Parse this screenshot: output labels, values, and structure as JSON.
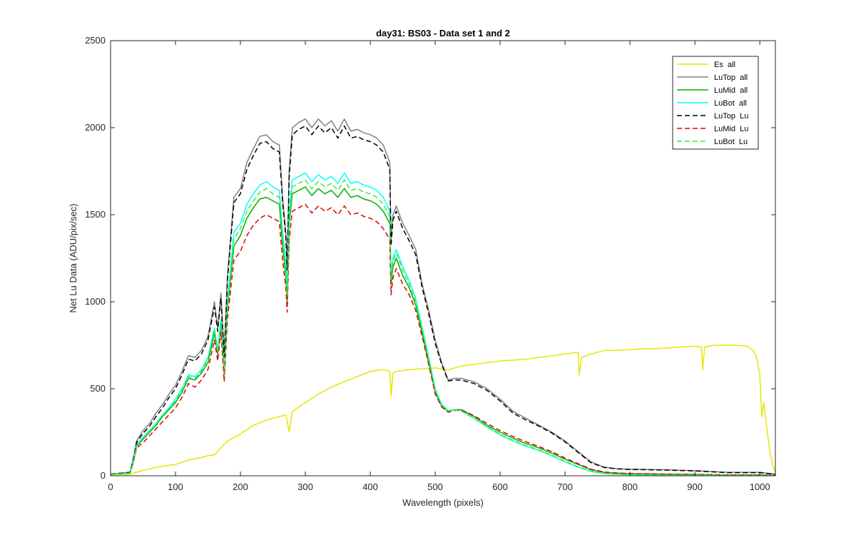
{
  "chart_data": {
    "type": "line",
    "title": "day31: BS03 - Data set 1 and 2",
    "xlabel": "Wavelength (pixels)",
    "ylabel": "Net Lu Data (ADU/pix/sec)",
    "xlim": [
      0,
      1024
    ],
    "ylim": [
      0,
      2500
    ],
    "xticks": [
      0,
      100,
      200,
      300,
      400,
      500,
      600,
      700,
      800,
      900,
      1000
    ],
    "yticks": [
      0,
      500,
      1000,
      1500,
      2000,
      2500
    ],
    "grid": false,
    "legend_position": "top-right",
    "series": [
      {
        "name": "Es  all",
        "color": "#e6e600",
        "dash": "solid",
        "x": [
          0,
          30,
          40,
          50,
          60,
          80,
          100,
          120,
          140,
          150,
          160,
          170,
          180,
          200,
          220,
          240,
          260,
          270,
          275,
          280,
          300,
          320,
          340,
          360,
          380,
          400,
          420,
          430,
          432,
          435,
          440,
          460,
          480,
          500,
          520,
          540,
          560,
          580,
          600,
          620,
          640,
          660,
          680,
          700,
          720,
          722,
          725,
          740,
          760,
          780,
          800,
          820,
          840,
          860,
          880,
          900,
          910,
          912,
          915,
          930,
          960,
          980,
          990,
          995,
          1000,
          1003,
          1006,
          1010,
          1015,
          1020,
          1024
        ],
        "y": [
          5,
          8,
          20,
          30,
          40,
          55,
          65,
          90,
          105,
          115,
          120,
          160,
          200,
          240,
          290,
          320,
          340,
          350,
          255,
          370,
          420,
          470,
          510,
          540,
          570,
          600,
          610,
          600,
          460,
          590,
          600,
          610,
          615,
          620,
          610,
          630,
          640,
          650,
          660,
          665,
          670,
          680,
          690,
          700,
          710,
          580,
          680,
          700,
          720,
          720,
          725,
          730,
          730,
          735,
          740,
          745,
          740,
          610,
          740,
          750,
          750,
          745,
          720,
          680,
          580,
          340,
          420,
          300,
          150,
          60,
          20
        ]
      },
      {
        "name": "LuTop  all",
        "color": "#808080",
        "dash": "solid",
        "x": [
          0,
          30,
          35,
          40,
          50,
          60,
          70,
          80,
          90,
          100,
          110,
          120,
          130,
          140,
          150,
          160,
          165,
          170,
          175,
          180,
          190,
          200,
          210,
          220,
          230,
          240,
          250,
          260,
          265,
          270,
          272,
          275,
          280,
          290,
          300,
          310,
          320,
          330,
          340,
          350,
          360,
          370,
          380,
          390,
          400,
          410,
          420,
          430,
          432,
          435,
          440,
          450,
          460,
          470,
          480,
          490,
          500,
          510,
          520,
          530,
          540,
          560,
          580,
          600,
          620,
          640,
          660,
          680,
          700,
          720,
          740,
          760,
          780,
          800,
          850,
          900,
          950,
          1000,
          1024
        ],
        "y": [
          10,
          20,
          100,
          200,
          260,
          300,
          360,
          410,
          470,
          520,
          600,
          690,
          680,
          720,
          800,
          1000,
          850,
          1050,
          700,
          1150,
          1600,
          1650,
          1800,
          1880,
          1950,
          1960,
          1920,
          1900,
          1600,
          1400,
          1200,
          1750,
          2000,
          2030,
          2050,
          2000,
          2050,
          2010,
          2040,
          1980,
          2050,
          1980,
          1990,
          1970,
          1960,
          1940,
          1900,
          1800,
          1350,
          1500,
          1550,
          1450,
          1380,
          1300,
          1100,
          950,
          780,
          650,
          550,
          560,
          560,
          540,
          500,
          440,
          370,
          330,
          290,
          250,
          200,
          140,
          80,
          50,
          40,
          38,
          35,
          30,
          20,
          20,
          10
        ]
      },
      {
        "name": "LuMid  all",
        "color": "#00b000",
        "dash": "solid",
        "x": [
          0,
          30,
          35,
          40,
          50,
          60,
          70,
          80,
          90,
          100,
          110,
          120,
          130,
          140,
          150,
          160,
          165,
          170,
          175,
          180,
          190,
          200,
          210,
          220,
          230,
          240,
          250,
          260,
          265,
          270,
          272,
          275,
          280,
          290,
          300,
          310,
          320,
          330,
          340,
          350,
          360,
          370,
          380,
          390,
          400,
          410,
          420,
          430,
          432,
          435,
          440,
          450,
          460,
          470,
          480,
          490,
          500,
          510,
          520,
          530,
          540,
          560,
          580,
          600,
          620,
          640,
          660,
          680,
          700,
          720,
          740,
          760,
          780,
          800,
          850,
          900,
          950,
          1000,
          1024
        ],
        "y": [
          8,
          15,
          80,
          170,
          210,
          250,
          290,
          340,
          380,
          420,
          480,
          560,
          550,
          590,
          650,
          820,
          700,
          880,
          580,
          960,
          1320,
          1380,
          1480,
          1540,
          1590,
          1600,
          1580,
          1560,
          1320,
          1150,
          1000,
          1440,
          1620,
          1640,
          1660,
          1610,
          1650,
          1620,
          1640,
          1600,
          1650,
          1600,
          1610,
          1590,
          1580,
          1560,
          1520,
          1450,
          1100,
          1200,
          1250,
          1150,
          1080,
          980,
          820,
          650,
          480,
          400,
          370,
          380,
          380,
          340,
          290,
          250,
          215,
          185,
          160,
          130,
          95,
          65,
          35,
          20,
          15,
          12,
          10,
          8,
          5,
          5,
          3
        ]
      },
      {
        "name": "LuBot  all",
        "color": "#00ffff",
        "dash": "solid",
        "x": [
          0,
          30,
          35,
          40,
          50,
          60,
          70,
          80,
          90,
          100,
          110,
          120,
          130,
          140,
          150,
          160,
          165,
          170,
          175,
          180,
          190,
          200,
          210,
          220,
          230,
          240,
          250,
          260,
          265,
          270,
          272,
          275,
          280,
          290,
          300,
          310,
          320,
          330,
          340,
          350,
          360,
          370,
          380,
          390,
          400,
          410,
          420,
          430,
          432,
          435,
          440,
          450,
          460,
          470,
          480,
          490,
          500,
          510,
          520,
          530,
          540,
          560,
          580,
          600,
          620,
          640,
          660,
          680,
          700,
          720,
          740,
          760,
          780,
          800,
          850,
          900,
          950,
          1000,
          1024
        ],
        "y": [
          8,
          15,
          85,
          180,
          220,
          260,
          300,
          350,
          390,
          440,
          500,
          580,
          570,
          610,
          680,
          850,
          720,
          900,
          600,
          1000,
          1400,
          1450,
          1560,
          1620,
          1670,
          1690,
          1660,
          1640,
          1400,
          1220,
          1060,
          1520,
          1700,
          1720,
          1740,
          1690,
          1730,
          1700,
          1720,
          1680,
          1740,
          1680,
          1690,
          1670,
          1660,
          1640,
          1600,
          1520,
          1150,
          1250,
          1300,
          1200,
          1120,
          1020,
          850,
          680,
          500,
          410,
          375,
          380,
          375,
          330,
          280,
          235,
          200,
          170,
          145,
          115,
          80,
          50,
          25,
          12,
          8,
          6,
          5,
          4,
          3,
          3,
          2
        ]
      },
      {
        "name": "LuTop  Lu",
        "color": "#000000",
        "dash": "dashed",
        "x": [
          0,
          30,
          35,
          40,
          50,
          60,
          70,
          80,
          90,
          100,
          110,
          120,
          130,
          140,
          150,
          160,
          165,
          170,
          175,
          180,
          190,
          200,
          210,
          220,
          230,
          240,
          250,
          260,
          265,
          270,
          272,
          275,
          280,
          290,
          300,
          310,
          320,
          330,
          340,
          350,
          360,
          370,
          380,
          390,
          400,
          410,
          420,
          430,
          432,
          435,
          440,
          450,
          460,
          470,
          480,
          490,
          500,
          510,
          520,
          530,
          540,
          560,
          580,
          600,
          620,
          640,
          660,
          680,
          700,
          720,
          740,
          760,
          780,
          800,
          850,
          900,
          950,
          1000,
          1024
        ],
        "y": [
          10,
          20,
          95,
          190,
          245,
          285,
          340,
          390,
          450,
          500,
          580,
          670,
          660,
          700,
          780,
          970,
          830,
          1020,
          680,
          1120,
          1570,
          1620,
          1760,
          1840,
          1910,
          1920,
          1880,
          1860,
          1570,
          1370,
          1180,
          1710,
          1960,
          1990,
          2010,
          1960,
          2010,
          1970,
          2000,
          1940,
          2010,
          1940,
          1950,
          1930,
          1920,
          1900,
          1860,
          1760,
          1320,
          1470,
          1520,
          1420,
          1350,
          1270,
          1080,
          930,
          760,
          640,
          545,
          550,
          550,
          530,
          490,
          430,
          360,
          320,
          285,
          245,
          195,
          135,
          75,
          48,
          40,
          36,
          33,
          28,
          18,
          18,
          8
        ]
      },
      {
        "name": "LuMid  Lu",
        "color": "#e00000",
        "dash": "dashed",
        "x": [
          0,
          30,
          35,
          40,
          50,
          60,
          70,
          80,
          90,
          100,
          110,
          120,
          130,
          140,
          150,
          160,
          165,
          170,
          175,
          180,
          190,
          200,
          210,
          220,
          230,
          240,
          250,
          260,
          265,
          270,
          272,
          275,
          280,
          290,
          300,
          310,
          320,
          330,
          340,
          350,
          360,
          370,
          380,
          390,
          400,
          410,
          420,
          430,
          432,
          435,
          440,
          450,
          460,
          470,
          480,
          490,
          500,
          510,
          520,
          530,
          540,
          560,
          580,
          600,
          620,
          640,
          660,
          680,
          700,
          720,
          740,
          760,
          780,
          800,
          850,
          900,
          950,
          1000,
          1024
        ],
        "y": [
          8,
          15,
          75,
          160,
          190,
          230,
          270,
          310,
          350,
          390,
          450,
          530,
          510,
          550,
          610,
          780,
          660,
          830,
          540,
          900,
          1240,
          1290,
          1380,
          1440,
          1480,
          1500,
          1480,
          1460,
          1240,
          1080,
          940,
          1350,
          1520,
          1540,
          1560,
          1510,
          1550,
          1520,
          1540,
          1500,
          1550,
          1500,
          1510,
          1490,
          1480,
          1460,
          1420,
          1360,
          1040,
          1140,
          1190,
          1100,
          1040,
          950,
          800,
          640,
          470,
          395,
          365,
          375,
          380,
          345,
          300,
          260,
          225,
          195,
          168,
          138,
          102,
          70,
          38,
          22,
          16,
          13,
          10,
          8,
          5,
          5,
          3
        ]
      },
      {
        "name": "LuBot  Lu",
        "color": "#33ee33",
        "dash": "dashed",
        "x": [
          0,
          30,
          35,
          40,
          50,
          60,
          70,
          80,
          90,
          100,
          110,
          120,
          130,
          140,
          150,
          160,
          165,
          170,
          175,
          180,
          190,
          200,
          210,
          220,
          230,
          240,
          250,
          260,
          265,
          270,
          272,
          275,
          280,
          290,
          300,
          310,
          320,
          330,
          340,
          350,
          360,
          370,
          380,
          390,
          400,
          410,
          420,
          430,
          432,
          435,
          440,
          450,
          460,
          470,
          480,
          490,
          500,
          510,
          520,
          530,
          540,
          560,
          580,
          600,
          620,
          640,
          660,
          680,
          700,
          720,
          740,
          760,
          780,
          800,
          850,
          900,
          950,
          1000,
          1024
        ],
        "y": [
          8,
          15,
          82,
          175,
          215,
          255,
          295,
          345,
          385,
          430,
          490,
          570,
          560,
          600,
          670,
          840,
          710,
          890,
          590,
          980,
          1360,
          1420,
          1520,
          1580,
          1630,
          1650,
          1620,
          1600,
          1360,
          1190,
          1030,
          1480,
          1660,
          1680,
          1700,
          1650,
          1690,
          1660,
          1680,
          1640,
          1700,
          1640,
          1650,
          1630,
          1620,
          1600,
          1560,
          1490,
          1130,
          1230,
          1280,
          1180,
          1100,
          1000,
          840,
          670,
          490,
          405,
          372,
          378,
          372,
          330,
          282,
          238,
          203,
          173,
          148,
          118,
          83,
          52,
          27,
          13,
          9,
          7,
          5,
          4,
          3,
          3,
          2
        ]
      }
    ]
  }
}
